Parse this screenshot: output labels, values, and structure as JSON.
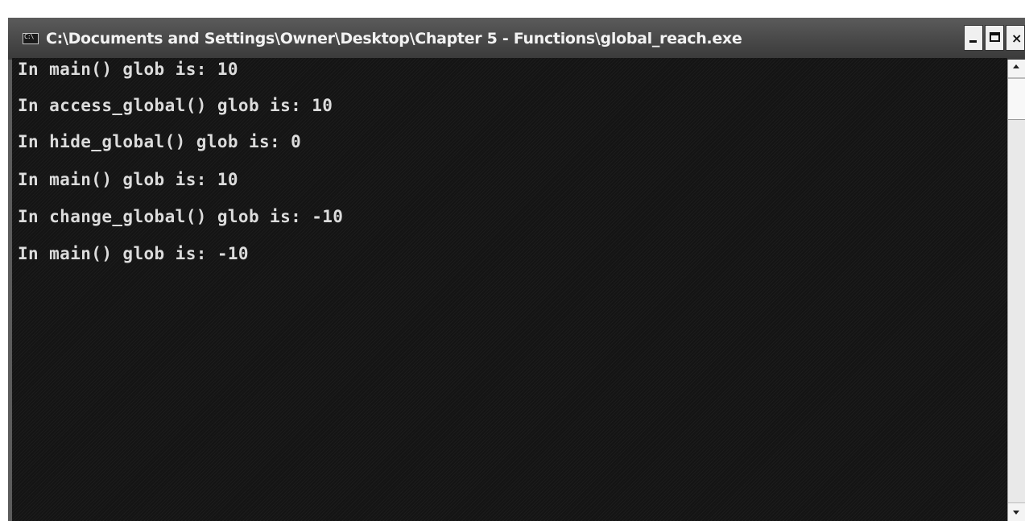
{
  "window": {
    "title": "C:\\Documents and Settings\\Owner\\Desktop\\Chapter 5 - Functions\\global_reach.exe",
    "app_icon": "console-icon",
    "buttons": {
      "minimize_icon": "minimize-icon",
      "maximize_icon": "maximize-icon",
      "close_icon": "close-icon",
      "close_glyph": "×"
    }
  },
  "console": {
    "lines": [
      "In main() glob is: 10",
      "In access_global() glob is: 10",
      "In hide_global() glob is: 0",
      "In main() glob is: 10",
      "In change_global() glob is: -10",
      "In main() glob is: -10"
    ],
    "text_color": "#dcdcdc",
    "background_color": "#141414"
  }
}
